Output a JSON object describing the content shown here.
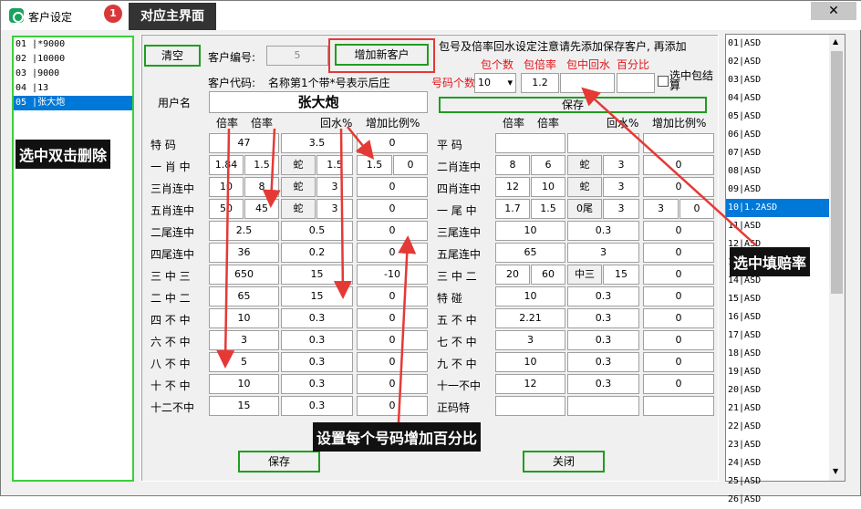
{
  "window": {
    "title": "客户设定",
    "badge": "1",
    "main_tab": "对应主界面",
    "close_glyph": "✕"
  },
  "left_list": {
    "items": [
      "01 |*9000",
      "02 |10000",
      "03 |9000",
      "04 |13",
      "05 |张大炮"
    ],
    "selected_index": 4,
    "callout": "选中双击删除"
  },
  "top": {
    "clear_button": "清空",
    "customer_no_label": "客户编号:",
    "customer_no_value": "5",
    "add_button": "增加新客户",
    "notice": "包号及倍率回水设定注意请先添加保存客户, 再添加",
    "code_label": "客户代码:",
    "code_hint": "名称第1个带*号表示后庄",
    "username_label": "用户名",
    "username_value": "张大炮"
  },
  "pack": {
    "hdr_count": "包个数",
    "hdr_rate": "包倍率",
    "hdr_rebate": "包中回水",
    "hdr_pct": "百分比",
    "num_count_label": "号码个数",
    "count_value": "10",
    "rate_value": "1.2",
    "rebate_value": "",
    "pct_value": "",
    "checkbox_label": "选中包结算",
    "save_button": "保存"
  },
  "left_grid": {
    "headers": [
      "倍率",
      "倍率",
      "回水%",
      "增加比例%"
    ],
    "rows": [
      {
        "label": "特  码",
        "r1": "47",
        "r2": "",
        "sel": "",
        "rb": "3.5",
        "inc": "0"
      },
      {
        "label": "一 肖 中",
        "r1": "1.84",
        "r2": "1.5",
        "sel": "蛇",
        "rb": "1.5",
        "inc": "1.5",
        "inc2": "0"
      },
      {
        "label": "三肖连中",
        "r1": "10",
        "r2": "8",
        "sel": "蛇",
        "rb": "3",
        "inc": "0"
      },
      {
        "label": "五肖连中",
        "r1": "50",
        "r2": "45",
        "sel": "蛇",
        "rb": "3",
        "inc": "0"
      },
      {
        "label": "二尾连中",
        "r1": "2.5",
        "r2": "",
        "sel": "",
        "rb": "0.5",
        "inc": "0"
      },
      {
        "label": "四尾连中",
        "r1": "36",
        "r2": "",
        "sel": "",
        "rb": "0.2",
        "inc": "0"
      },
      {
        "label": "三 中 三",
        "r1": "650",
        "r2": "",
        "sel": "",
        "rb": "15",
        "inc": "-10"
      },
      {
        "label": "二 中 二",
        "r1": "65",
        "r2": "",
        "sel": "",
        "rb": "15",
        "inc": "0"
      },
      {
        "label": "四 不 中",
        "r1": "10",
        "r2": "",
        "sel": "",
        "rb": "0.3",
        "inc": "0"
      },
      {
        "label": "六 不 中",
        "r1": "3",
        "r2": "",
        "sel": "",
        "rb": "0.3",
        "inc": "0"
      },
      {
        "label": "八 不 中",
        "r1": "5",
        "r2": "",
        "sel": "",
        "rb": "0.3",
        "inc": "0"
      },
      {
        "label": "十 不 中",
        "r1": "10",
        "r2": "",
        "sel": "",
        "rb": "0.3",
        "inc": "0"
      },
      {
        "label": "十二不中",
        "r1": "15",
        "r2": "",
        "sel": "",
        "rb": "0.3",
        "inc": "0"
      }
    ]
  },
  "right_grid": {
    "headers": [
      "倍率",
      "倍率",
      "回水%",
      "增加比例%"
    ],
    "rows": [
      {
        "label": "平  码",
        "r1": "",
        "r2": "",
        "sel": "",
        "rb": "",
        "inc": ""
      },
      {
        "label": "二肖连中",
        "r1": "8",
        "r2": "6",
        "sel": "蛇",
        "rb": "3",
        "inc": "0"
      },
      {
        "label": "四肖连中",
        "r1": "12",
        "r2": "10",
        "sel": "蛇",
        "rb": "3",
        "inc": "0"
      },
      {
        "label": "一 尾 中",
        "r1": "1.7",
        "r2": "1.5",
        "sel": "0尾",
        "rb": "3",
        "inc": "3",
        "inc2": "0"
      },
      {
        "label": "三尾连中",
        "r1": "10",
        "r2": "",
        "sel": "",
        "rb": "0.3",
        "inc": "0"
      },
      {
        "label": "五尾连中",
        "r1": "65",
        "r2": "",
        "sel": "",
        "rb": "3",
        "inc": "0"
      },
      {
        "label": "三 中 二",
        "r1": "20",
        "r2": "60",
        "sel": "中三",
        "rb": "15",
        "inc": "0"
      },
      {
        "label": "特  碰",
        "r1": "10",
        "r2": "",
        "sel": "",
        "rb": "0.3",
        "inc": "0"
      },
      {
        "label": "五 不 中",
        "r1": "2.21",
        "r2": "",
        "sel": "",
        "rb": "0.3",
        "inc": "0"
      },
      {
        "label": "七 不 中",
        "r1": "3",
        "r2": "",
        "sel": "",
        "rb": "0.3",
        "inc": "0"
      },
      {
        "label": "九 不 中",
        "r1": "10",
        "r2": "",
        "sel": "",
        "rb": "0.3",
        "inc": "0"
      },
      {
        "label": "十一不中",
        "r1": "12",
        "r2": "",
        "sel": "",
        "rb": "0.3",
        "inc": "0"
      },
      {
        "label": "正码特",
        "r1": "",
        "r2": "",
        "sel": "",
        "rb": "",
        "inc": ""
      }
    ]
  },
  "bottom": {
    "save_button": "保存",
    "close_button": "关闭",
    "callout": "设置每个号码增加百分比"
  },
  "right_list": {
    "items": [
      "01|ASD",
      "02|ASD",
      "03|ASD",
      "04|ASD",
      "05|ASD",
      "06|ASD",
      "07|ASD",
      "08|ASD",
      "09|ASD",
      "10|1.2ASD",
      "11|ASD",
      "12|ASD",
      "13|ASD",
      "14|ASD",
      "15|ASD",
      "16|ASD",
      "17|ASD",
      "18|ASD",
      "19|ASD",
      "20|ASD",
      "21|ASD",
      "22|ASD",
      "23|ASD",
      "24|ASD",
      "25|ASD",
      "26|ASD"
    ],
    "selected_index": 9,
    "callout": "选中填赔率"
  },
  "colors": {
    "accent": "#0078d7",
    "green_border": "#1e9e1e",
    "red": "#e53935",
    "callout_bg": "#111111"
  }
}
